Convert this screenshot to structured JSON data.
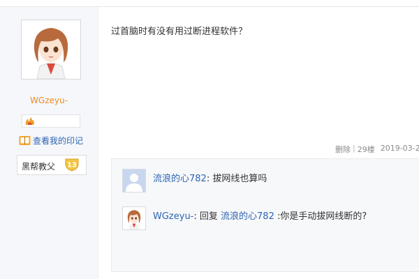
{
  "author": {
    "username": "WGzeyu-",
    "avatar_icon": "anime-girl-avatar-icon",
    "mark_link": "查看我的印记",
    "level_name": "黑帮教父",
    "level_number": "13"
  },
  "post": {
    "content": "过首脑时有没有用过断进程软件？",
    "delete_label": "删除",
    "separator": "|",
    "floor": "29楼",
    "time": "2019-03-2"
  },
  "replies": [
    {
      "user": "流浪的心782",
      "colon": ":",
      "text": " 拔网线也算吗",
      "avatar_icon": "default-user-avatar-icon"
    },
    {
      "user": "WGzeyu-",
      "colon": ":",
      "reply_word": " 回复 ",
      "target": "流浪的心782",
      "text": " :你是手动拔网线断的?",
      "avatar_icon": "anime-girl-avatar-icon"
    }
  ],
  "colors": {
    "username": "#f08a24",
    "link": "#2d64b3",
    "sidebar_bg": "#f5f7fa",
    "level_badge": "#f5c542"
  }
}
